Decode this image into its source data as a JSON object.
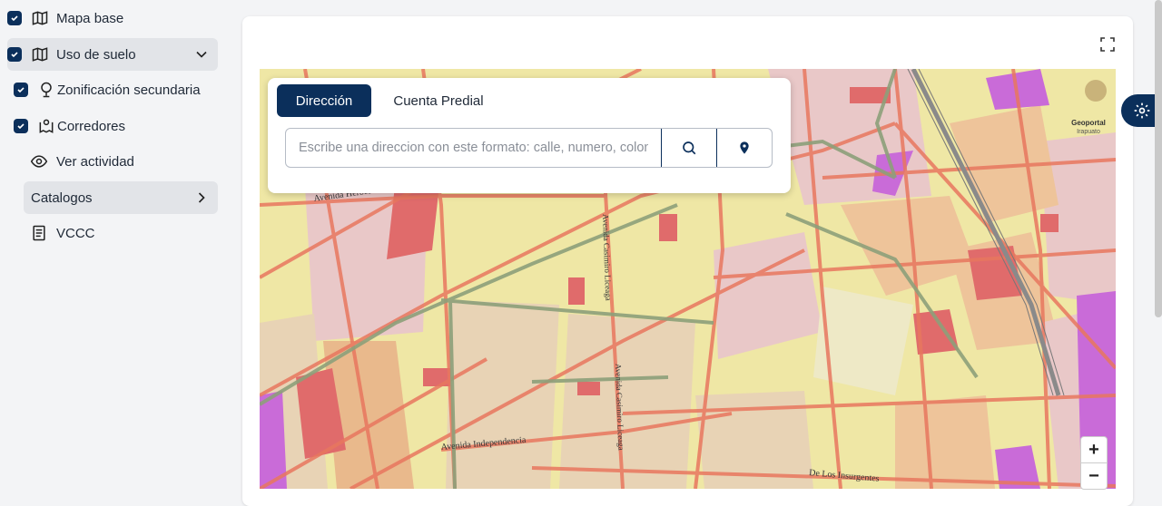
{
  "sidebar": {
    "items": [
      {
        "label": "Mapa base",
        "icon": "map-icon",
        "checked": true
      },
      {
        "label": "Uso de suelo",
        "icon": "map-icon",
        "checked": true,
        "expanded": true
      },
      {
        "label": "Zonificación secundaria",
        "icon": "pin-icon",
        "checked": true
      },
      {
        "label": "Corredores",
        "icon": "map-pin-icon",
        "checked": true
      },
      {
        "label": "Ver actividad",
        "icon": "eye-icon"
      },
      {
        "label": "Catalogos",
        "icon": "chevron-right-icon"
      },
      {
        "label": "VCCC",
        "icon": "document-icon"
      }
    ]
  },
  "search": {
    "tabs": [
      {
        "label": "Dirección",
        "active": true
      },
      {
        "label": "Cuenta Predial",
        "active": false
      }
    ],
    "placeholder": "Escribe una direccion con este formato: calle, numero, colonia"
  },
  "map": {
    "labels": {
      "heroes": "Avenida Heroes de Nacozari",
      "casimiro1": "Avenida Casimiro Liceaga",
      "casimiro2": "Avenida Casimiro Liceaga",
      "independencia": "Avenida Independencia",
      "insurgentes": "De Los Insurgentes"
    },
    "logo_title": "Geoportal",
    "logo_sub": "Irapuato",
    "zoom_in": "+",
    "zoom_out": "−"
  },
  "colors": {
    "primary": "#0b2f5b",
    "road": "#e8775f",
    "residential": "#efe7a5",
    "commercial": "#e9a7a7",
    "industrial": "#c96bd8"
  }
}
